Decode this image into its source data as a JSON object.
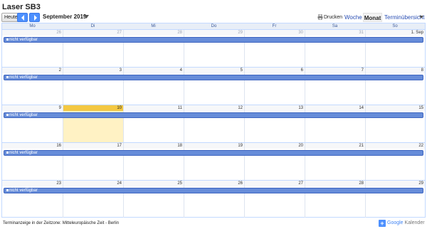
{
  "calendar_title": "Laser SB3",
  "toolbar": {
    "today_label": "Heute",
    "period_label": "September 2019",
    "print_label": "Drucken",
    "views": {
      "week": "Woche",
      "month": "Monat",
      "agenda": "Terminübersicht"
    }
  },
  "weekdays": [
    "Mo",
    "Di",
    "Mi",
    "Do",
    "Fr",
    "Sa",
    "So"
  ],
  "weeks": [
    {
      "days": [
        {
          "label": "26",
          "other_month": true
        },
        {
          "label": "27",
          "other_month": true
        },
        {
          "label": "28",
          "other_month": true
        },
        {
          "label": "29",
          "other_month": true
        },
        {
          "label": "30",
          "other_month": true
        },
        {
          "label": "31",
          "other_month": true
        },
        {
          "label": "1. Sep",
          "other_month": false
        }
      ],
      "event": "nicht verfügbar"
    },
    {
      "days": [
        {
          "label": "2"
        },
        {
          "label": "3"
        },
        {
          "label": "4"
        },
        {
          "label": "5"
        },
        {
          "label": "6"
        },
        {
          "label": "7"
        },
        {
          "label": "8"
        }
      ],
      "event": "nicht verfügbar"
    },
    {
      "days": [
        {
          "label": "9"
        },
        {
          "label": "10",
          "today": true
        },
        {
          "label": "11"
        },
        {
          "label": "12"
        },
        {
          "label": "13"
        },
        {
          "label": "14"
        },
        {
          "label": "15"
        }
      ],
      "event": "nicht verfügbar"
    },
    {
      "days": [
        {
          "label": "16"
        },
        {
          "label": "17"
        },
        {
          "label": "18"
        },
        {
          "label": "19"
        },
        {
          "label": "20"
        },
        {
          "label": "21"
        },
        {
          "label": "22"
        }
      ],
      "event": "nicht verfügbar"
    },
    {
      "days": [
        {
          "label": "23"
        },
        {
          "label": "24"
        },
        {
          "label": "25"
        },
        {
          "label": "26"
        },
        {
          "label": "27"
        },
        {
          "label": "28"
        },
        {
          "label": "29"
        }
      ],
      "event": "nicht verfügbar"
    }
  ],
  "footer": {
    "timezone_note": "Terminanzeige in der Zeitzone: Mitteleuropäische Zeit - Berlin",
    "brand_google": "Google",
    "brand_kalender": "Kalender"
  },
  "colors": {
    "accent": "#4d90fe",
    "event": "#668cd9",
    "today": "#f4c842",
    "today_bg": "#fff2c4"
  },
  "icons": {
    "prev": "chevron-left-icon",
    "next": "chevron-right-icon",
    "print": "printer-icon",
    "caret": "dropdown-caret-icon",
    "add": "plus-icon"
  }
}
